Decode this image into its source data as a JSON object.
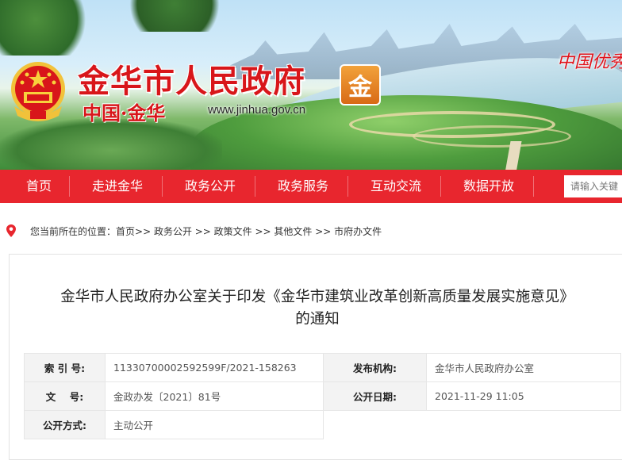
{
  "header": {
    "site_title": "金华市人民政府",
    "badge_char": "金",
    "subtitle_left": "中国",
    "subtitle_dot": "·",
    "subtitle_right": "金华",
    "url": "www.jinhua.gov.cn",
    "slogan": "中国优秀"
  },
  "nav": {
    "items": [
      "首页",
      "走进金华",
      "政务公开",
      "政务服务",
      "互动交流",
      "数据开放"
    ],
    "search_placeholder": "请输入关键"
  },
  "breadcrumb": {
    "prefix": "您当前所在的位置：",
    "path": "首页>> 政务公开 >> 政策文件 >> 其他文件 >> 市府办文件"
  },
  "article": {
    "title_line1": "金华市人民政府办公室关于印发《金华市建筑业改革创新高质量发展实施意见》",
    "title_line2": "的通知"
  },
  "meta": {
    "index_label": "索 引 号:",
    "index_value": "11330700002592599F/2021-158263",
    "org_label": "发布机构:",
    "org_value": "金华市人民政府办公室",
    "doc_label": "文    号:",
    "doc_value": "金政办发〔2021〕81号",
    "date_label": "公开日期:",
    "date_value": "2021-11-29 11:05",
    "mode_label": "公开方式:",
    "mode_value": "主动公开"
  },
  "colors": {
    "brand_red": "#e8262e",
    "title_red": "#d8161a"
  }
}
